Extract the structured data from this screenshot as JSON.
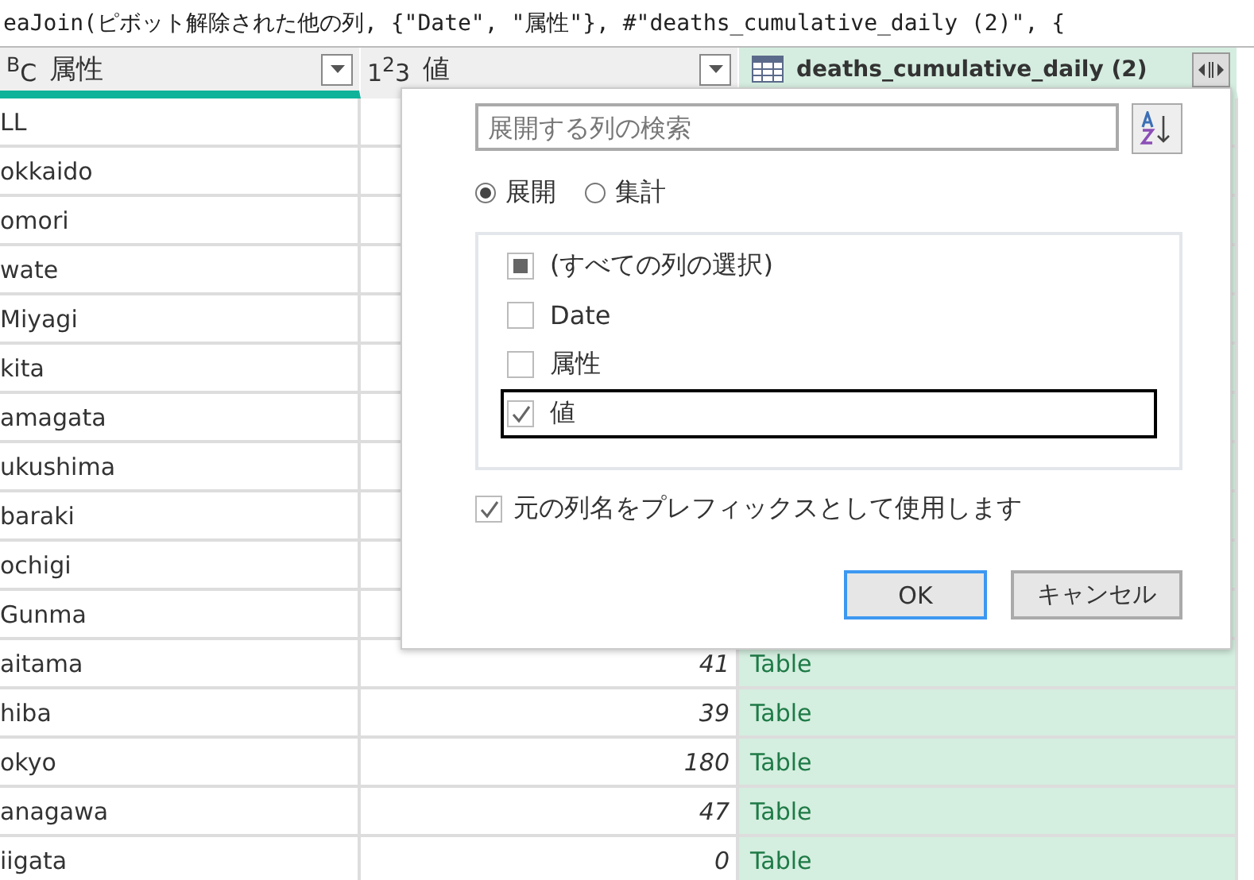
{
  "formula_bar": {
    "text": "eaJoin(ピボット解除された他の列, {\"Date\", \"属性\"}, #\"deaths_cumulative_daily (2)\", {"
  },
  "columns": [
    {
      "kind": "text",
      "type_label": "$^{B}$C",
      "name": "属性"
    },
    {
      "kind": "number",
      "type_label": "1$^{2}$3",
      "name": "値"
    },
    {
      "kind": "table",
      "name": "deaths_cumulative_daily (2)"
    }
  ],
  "rows": [
    {
      "name": "LL"
    },
    {
      "name": "okkaido"
    },
    {
      "name": "omori"
    },
    {
      "name": "wate"
    },
    {
      "name": "Miyagi"
    },
    {
      "name": "kita"
    },
    {
      "name": "amagata"
    },
    {
      "name": "ukushima"
    },
    {
      "name": "baraki"
    },
    {
      "name": "ochigi"
    },
    {
      "name": "Gunma"
    },
    {
      "name": "aitama",
      "value": "41",
      "table": "Table"
    },
    {
      "name": "hiba",
      "value": "39",
      "table": "Table"
    },
    {
      "name": "okyo",
      "value": "180",
      "table": "Table"
    },
    {
      "name": "anagawa",
      "value": "47",
      "table": "Table"
    },
    {
      "name": "iigata",
      "value": "0",
      "table": "Table"
    }
  ],
  "expand_dialog": {
    "search": {
      "placeholder": "展開する列の検索"
    },
    "modes": [
      {
        "label": "展開",
        "selected": true
      },
      {
        "label": "集計",
        "selected": false
      }
    ],
    "column_list": [
      {
        "label": "(すべての列の選択)",
        "checked": false,
        "indeterminate": true,
        "selected": false
      },
      {
        "label": "Date",
        "checked": false,
        "selected": false
      },
      {
        "label": "属性",
        "checked": false,
        "selected": false
      },
      {
        "label": "値",
        "checked": true,
        "selected": true
      }
    ],
    "prefix_option": {
      "label": "元の列名をプレフィックスとして使用します",
      "checked": true
    },
    "buttons": [
      {
        "label": "OK",
        "default": true
      },
      {
        "label": "キャンセル",
        "default": false
      }
    ]
  }
}
